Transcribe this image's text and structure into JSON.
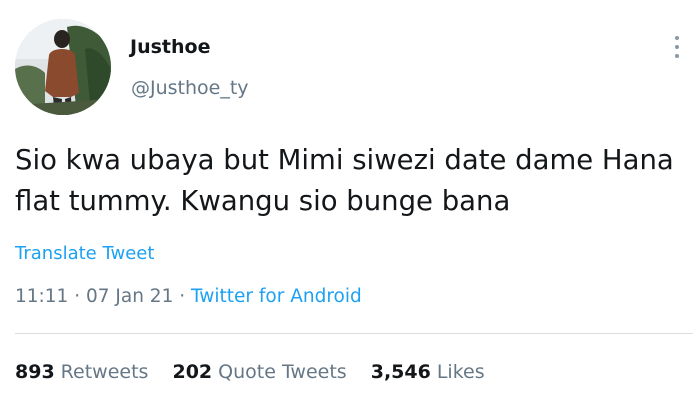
{
  "tweet": {
    "display_name": "Justhoe",
    "handle": "@Justhoe_ty",
    "text_line1": "Sio kwa ubaya but Mimi siwezi date dame Hana",
    "text_line2": "flat tummy. Kwangu sio bunge bana",
    "translate_label": "Translate Tweet",
    "time": "11:11",
    "sep1": " · ",
    "date": "07 Jan 21",
    "sep2": " · ",
    "source": "Twitter for Android"
  },
  "stats": {
    "retweets_count": "893",
    "retweets_label": "Retweets",
    "quotes_count": "202",
    "quotes_label": "Quote Tweets",
    "likes_count": "3,546",
    "likes_label": "Likes"
  },
  "icons": {
    "more": "more-vertical-icon"
  },
  "colors": {
    "link": "#1da1f2",
    "secondary_text": "#657786",
    "primary_text": "#14171a"
  }
}
